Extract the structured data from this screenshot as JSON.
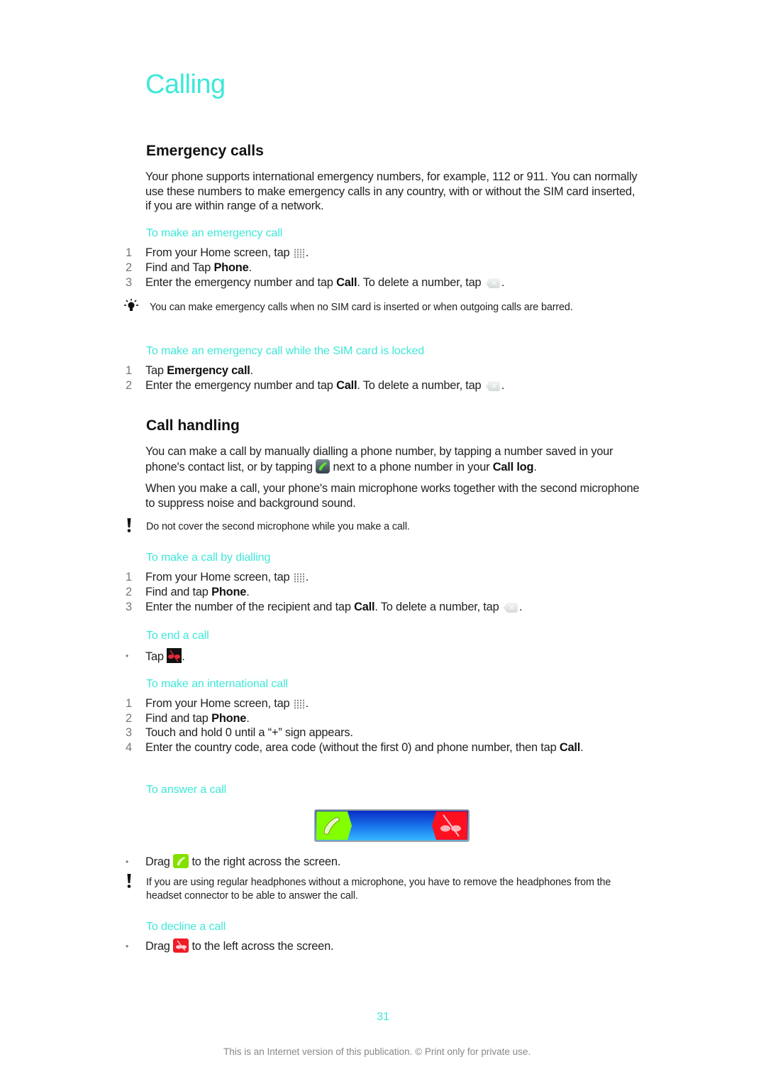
{
  "page": {
    "title": "Calling",
    "page_number": "31",
    "footer": "This is an Internet version of this publication. © Print only for private use."
  },
  "emergency": {
    "heading": "Emergency calls",
    "intro": "Your phone supports international emergency numbers, for example, 112 or 911. You can normally use these numbers to make emergency calls in any country, with or without the SIM card inserted, if you are within range of a network.",
    "make_call": {
      "title": "To make an emergency call",
      "steps": [
        {
          "num": "1",
          "pre": "From your Home screen, tap ",
          "icon": "app-grid-icon",
          "post": "."
        },
        {
          "num": "2",
          "pre": "Find and Tap ",
          "bold": "Phone",
          "post": "."
        },
        {
          "num": "3",
          "pre": "Enter the emergency number and tap ",
          "bold": "Call",
          "mid": ". To delete a number, tap ",
          "icon": "delete-icon",
          "post": "."
        }
      ]
    },
    "tip": "You can make emergency calls when no SIM card is inserted or when outgoing calls are barred.",
    "locked": {
      "title": "To make an emergency call while the SIM card is locked",
      "steps": [
        {
          "num": "1",
          "pre": "Tap ",
          "bold": "Emergency call",
          "post": "."
        },
        {
          "num": "2",
          "pre": "Enter the emergency number and tap ",
          "bold": "Call",
          "mid": ". To delete a number, tap ",
          "icon": "delete-icon",
          "post": "."
        }
      ]
    }
  },
  "handling": {
    "heading": "Call handling",
    "intro1_a": "You can make a call by manually dialling a phone number, by tapping a number saved in your phone's contact list, or by tapping ",
    "intro1_b": " next to a phone number in your ",
    "intro1_bold": "Call log",
    "intro1_c": ".",
    "intro2": "When you make a call, your phone's main microphone works together with the second microphone to suppress noise and background sound.",
    "warning1": "Do not cover the second microphone while you make a call.",
    "dialling": {
      "title": "To make a call by dialling",
      "steps": [
        {
          "num": "1",
          "pre": "From your Home screen, tap ",
          "post": "."
        },
        {
          "num": "2",
          "pre": "Find and tap ",
          "bold": "Phone",
          "post": "."
        },
        {
          "num": "3",
          "pre": "Enter the number of the recipient and tap ",
          "bold": "Call",
          "mid": ". To delete a number, tap ",
          "post": "."
        }
      ]
    },
    "end": {
      "title": "To end a call",
      "bullet": "•",
      "pre": "Tap ",
      "post": "."
    },
    "international": {
      "title": "To make an international call",
      "steps": [
        {
          "num": "1",
          "pre": "From your Home screen, tap ",
          "post": "."
        },
        {
          "num": "2",
          "pre": "Find and tap ",
          "bold": "Phone",
          "post": "."
        },
        {
          "num": "3",
          "pre": "Touch and hold 0 until a “+” sign appears."
        },
        {
          "num": "4",
          "pre": "Enter the country code, area code (without the first 0) and phone number, then tap ",
          "bold": "Call",
          "post": "."
        }
      ]
    },
    "answer": {
      "title": "To answer a call",
      "bullet": "•",
      "pre": "Drag ",
      "post": " to the right across the screen."
    },
    "warning2": "If you are using regular headphones without a microphone, you have to remove the headphones from the headset connector to be able to answer the call.",
    "decline": {
      "title": "To decline a call",
      "bullet": "•",
      "pre": "Drag ",
      "post": " to the left across the screen."
    }
  },
  "icons": {
    "tip": "lightbulb-icon",
    "warning": "exclamation-icon",
    "apps": "app-grid-icon",
    "delete": "delete-icon",
    "call": "call-icon",
    "end_call": "end-call-icon",
    "answer": "answer-icon",
    "decline": "decline-icon"
  },
  "colors": {
    "accent": "#3ee8d8",
    "answer_green": "#84ff00",
    "decline_red": "#ff1020",
    "slider_blue": "#1c7ff0"
  }
}
